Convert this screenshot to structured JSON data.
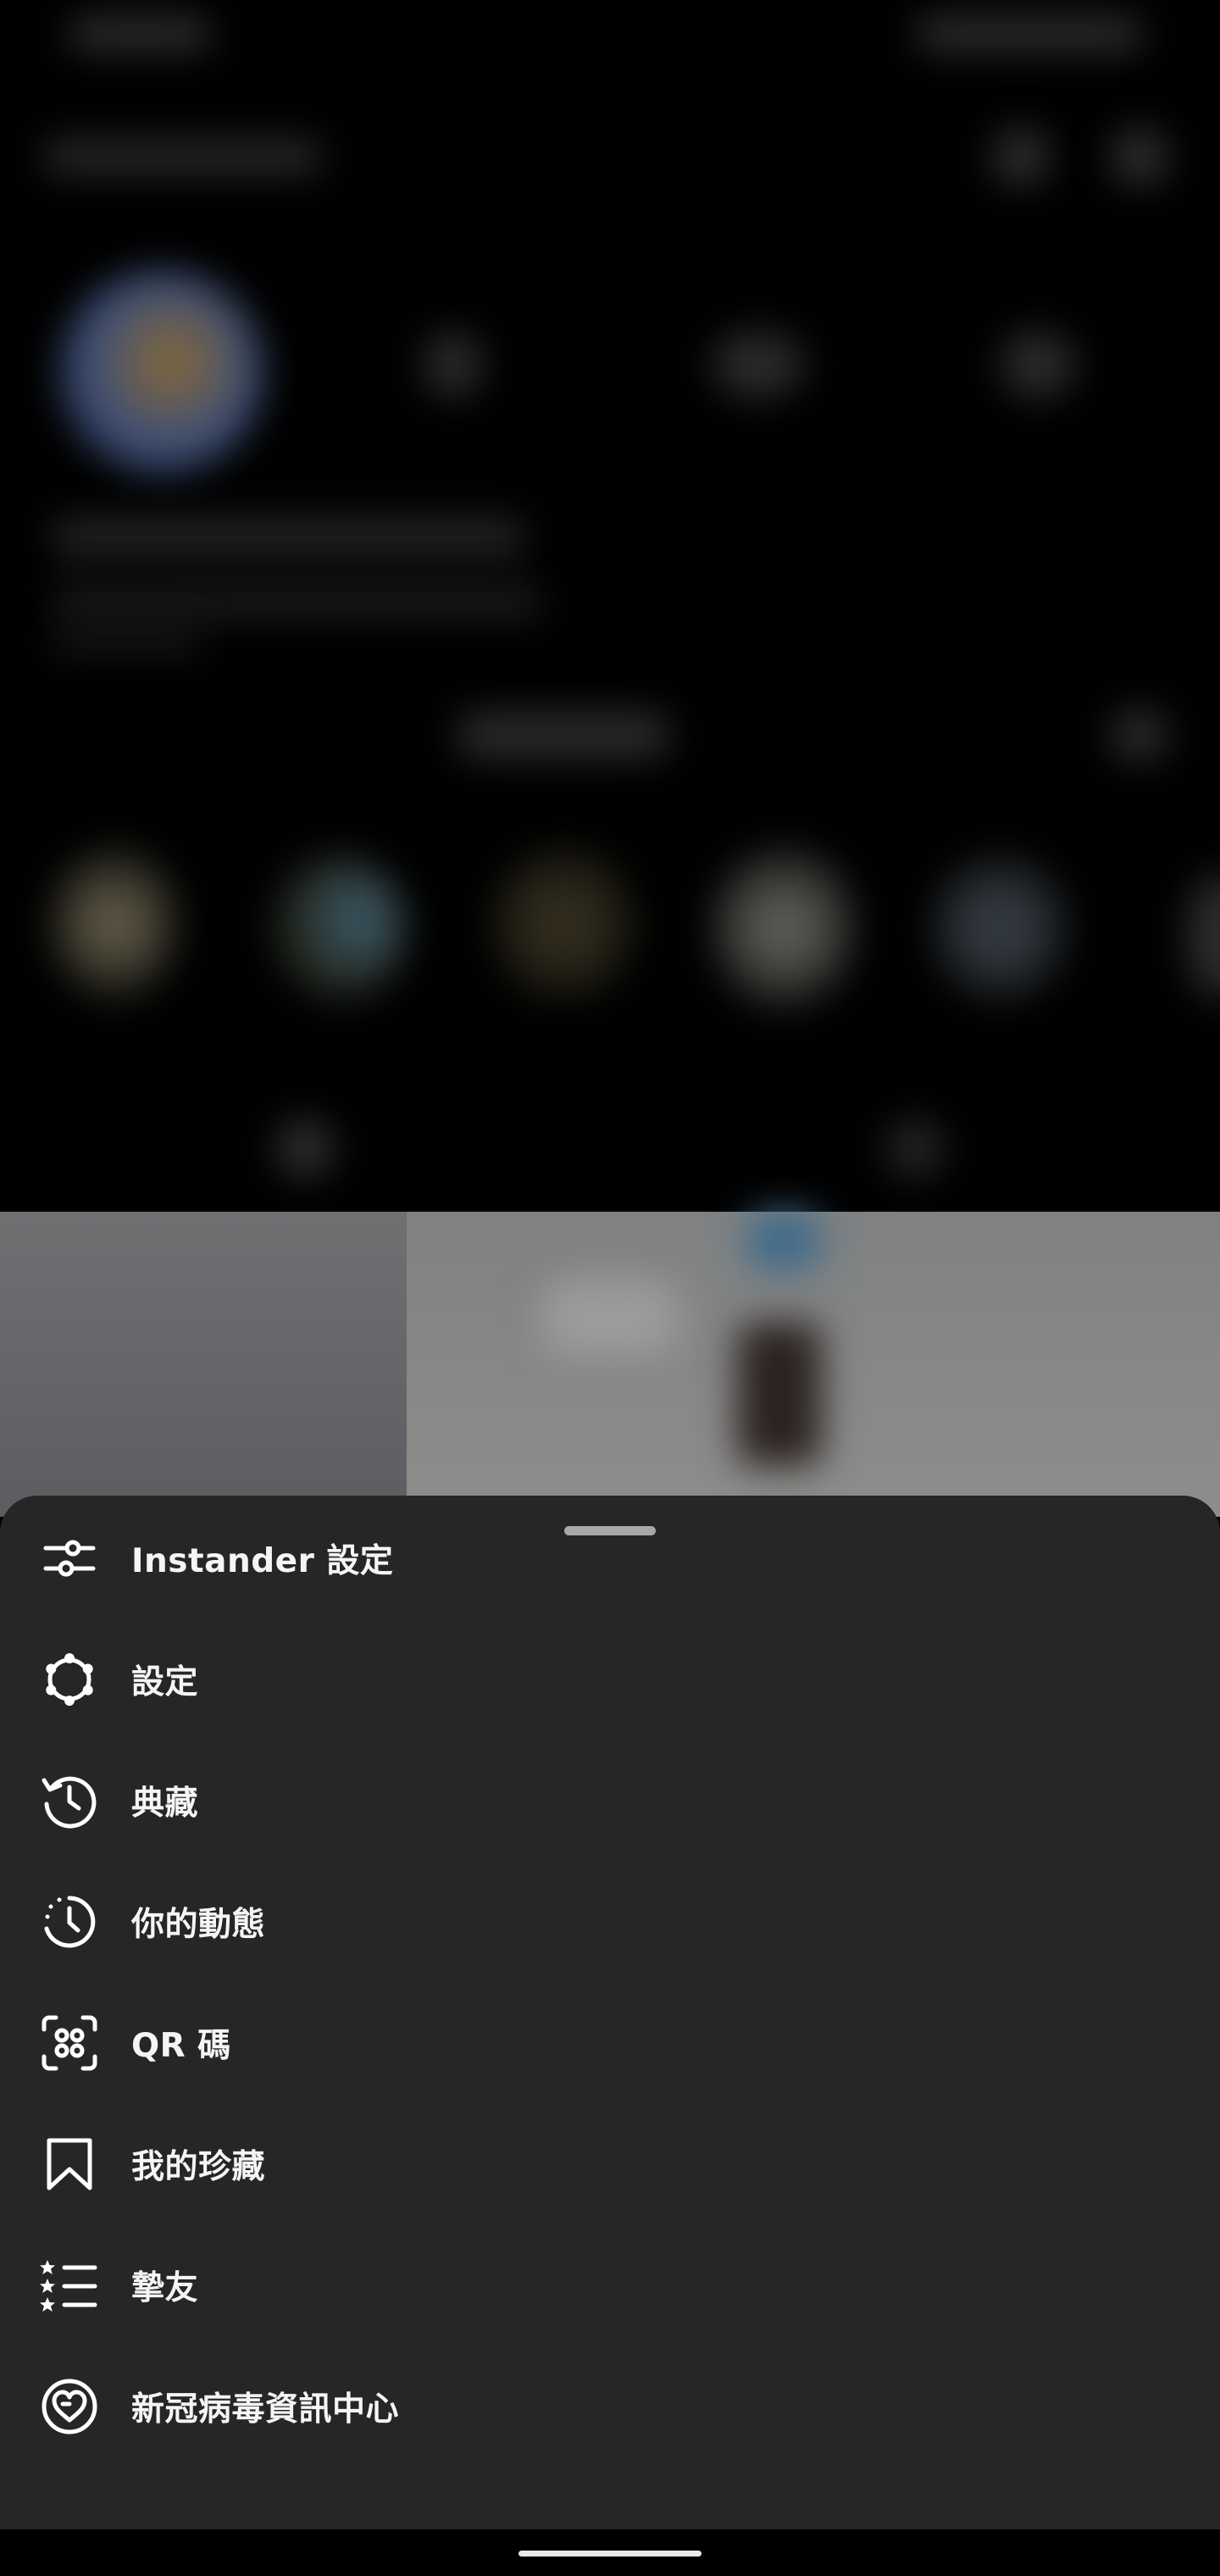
{
  "menu": {
    "items": [
      {
        "label": "Instander 設定",
        "icon": "sliders-icon"
      },
      {
        "label": "設定",
        "icon": "gear-icon"
      },
      {
        "label": "典藏",
        "icon": "archive-history-icon"
      },
      {
        "label": "你的動態",
        "icon": "activity-clock-icon"
      },
      {
        "label": "QR 碼",
        "icon": "qr-code-icon"
      },
      {
        "label": "我的珍藏",
        "icon": "bookmark-icon"
      },
      {
        "label": "摯友",
        "icon": "close-friends-list-icon"
      },
      {
        "label": "新冠病毒資訊中心",
        "icon": "covid-heart-icon"
      }
    ]
  },
  "colors": {
    "sheet_background": "#262626",
    "text": "#f5f5f5",
    "icon": "#ffffff",
    "handle": "#a8a8a8",
    "backdrop": "#000000"
  }
}
